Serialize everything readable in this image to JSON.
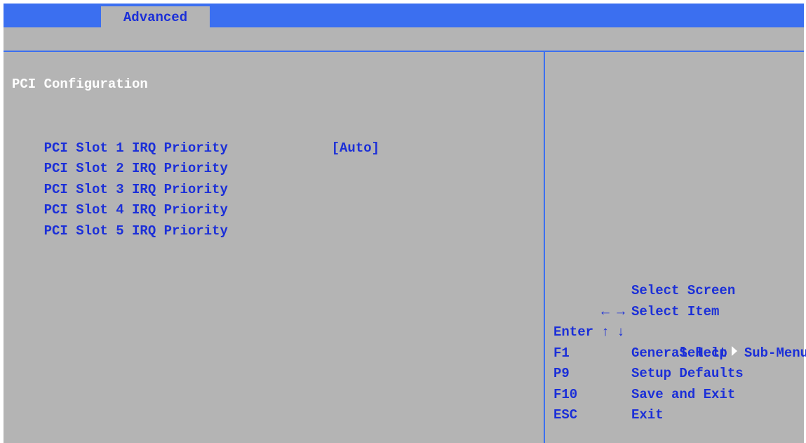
{
  "tabs": {
    "active_label": "Advanced"
  },
  "page": {
    "title": "PCI Configuration"
  },
  "settings": [
    {
      "label": "PCI Slot 1 IRQ Priority",
      "value": "[Auto]"
    },
    {
      "label": "PCI Slot 2 IRQ Priority",
      "value": ""
    },
    {
      "label": "PCI Slot 3 IRQ Priority",
      "value": ""
    },
    {
      "label": "PCI Slot 4 IRQ Priority",
      "value": ""
    },
    {
      "label": "PCI Slot 5 IRQ Priority",
      "value": ""
    }
  ],
  "help": {
    "keys": [
      {
        "key": "",
        "icons": [
          "left-arrow-icon",
          "right-arrow-icon"
        ],
        "glyphs": [
          "←",
          "→"
        ],
        "action": "Select Screen"
      },
      {
        "key": "",
        "icons": [
          "up-arrow-icon",
          "down-arrow-icon"
        ],
        "glyphs": [
          "↑",
          "↓"
        ],
        "action": "Select Item"
      },
      {
        "key": "Enter",
        "action_prefix": "Select",
        "icon": "submenu-triangle-icon",
        "action_suffix": "Sub-Menu"
      },
      {
        "key": "F1",
        "action": "General Help"
      },
      {
        "key": "P9",
        "action": "Setup Defaults"
      },
      {
        "key": "F10",
        "action": "Save and Exit"
      },
      {
        "key": "ESC",
        "action": "Exit"
      }
    ]
  },
  "colors": {
    "accent_blue": "#3b6ff0",
    "panel_gray": "#b4b4b4",
    "text_blue": "#1b2fd8",
    "title_white": "#ffffff"
  }
}
